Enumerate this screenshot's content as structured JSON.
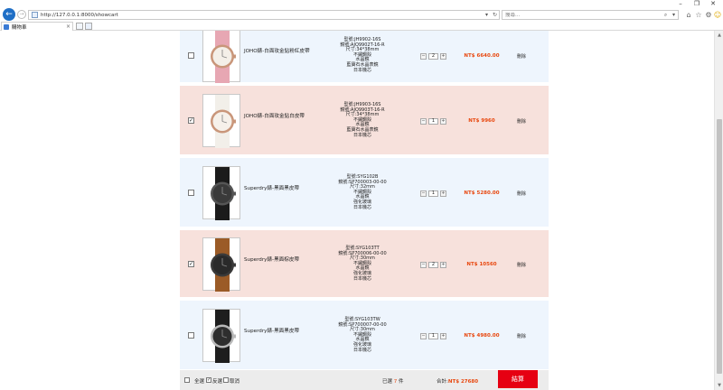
{
  "browser": {
    "url": "http://127.0.0.1:8000/showcart",
    "search_placeholder": "搜尋...",
    "tab_title": "購物車"
  },
  "cart": {
    "items": [
      {
        "checked": false,
        "name": "JOHO錶-白面玫金鉆粉紅皮帶",
        "spec": [
          "型號:JH9902-16S",
          "鏡號:AJQ9902T-16-R",
          "尺寸:34*38mm",
          "不鏽鋼殼",
          "水晶鏡",
          "藍寶石水晶表鏡",
          "日本機芯"
        ],
        "qty": "2",
        "price": "NT$ 6640.00",
        "delete": "刪除",
        "watch": "pink-leather"
      },
      {
        "checked": true,
        "name": "JOHO錶-白面玫金鉆白皮帶",
        "spec": [
          "型號:JH9903-16S",
          "鏡號:AJQ9903T-16-R",
          "尺寸:34*38mm",
          "不鏽鋼殼",
          "水晶鏡",
          "藍寶石水晶表鏡",
          "日本機芯"
        ],
        "qty": "1",
        "price": "NT$ 9960",
        "delete": "刪除",
        "watch": "white-leather"
      },
      {
        "checked": false,
        "name": "Superdry錶-黑面黑皮帶",
        "spec": [
          "型號:SYG102B",
          "鏡號:SP700003-00-00",
          "尺寸:32mm",
          "不鏽鋼殼",
          "水晶鏡",
          "強化玻璃",
          "日本機芯"
        ],
        "qty": "1",
        "price": "NT$ 5280.00",
        "delete": "刪除",
        "watch": "black-leather"
      },
      {
        "checked": true,
        "name": "Superdry錶-黑面棕皮帶",
        "spec": [
          "型號:SYG103TT",
          "鏡號:SP700006-00-00",
          "尺寸:30mm",
          "不鏽鋼殼",
          "水晶鏡",
          "強化玻璃",
          "日本機芯"
        ],
        "qty": "2",
        "price": "NT$ 10560",
        "delete": "刪除",
        "watch": "brown-leather"
      },
      {
        "checked": false,
        "name": "Superdry錶-黑面黑皮帶",
        "spec": [
          "型號:SYG103TW",
          "鏡號:SP700007-00-00",
          "尺寸:30mm",
          "不鏽鋼殼",
          "水晶鏡",
          "強化玻璃",
          "日本機芯"
        ],
        "qty": "1",
        "price": "NT$ 4980.00",
        "delete": "刪除",
        "watch": "black-leather-silver"
      }
    ]
  },
  "footer": {
    "select_all": "全選",
    "invert": "反選",
    "cancel": "取消",
    "selected_prefix": "已選",
    "selected_count": "7",
    "selected_suffix": "件",
    "total_label": "合計:",
    "total_value": "NT$ 27680",
    "checkout": "結算"
  },
  "colors": {
    "accent": "#e8470e",
    "checkout": "#e60012",
    "row_blue": "#eef5fd",
    "row_pink": "#f7e1dc"
  }
}
